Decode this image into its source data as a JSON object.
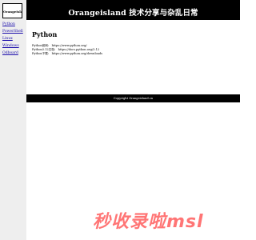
{
  "site": {
    "logo_text": "Orangeisland",
    "title": "Orangeisland 技术分享与杂乱日常"
  },
  "sidebar": {
    "items": [
      {
        "label": "Python"
      },
      {
        "label": "PowerShell"
      },
      {
        "label": "Linux"
      },
      {
        "label": "Windows"
      },
      {
        "label": "Odboard"
      }
    ]
  },
  "main": {
    "heading": "Python",
    "links": [
      {
        "text": "Python官网： https://www.python.org/"
      },
      {
        "text": "Python3.12文档： https://docs.python.org/3.12"
      },
      {
        "text": "Python下载： https://www.python.org/downloads"
      }
    ]
  },
  "footer": {
    "text": "Copyright Orangeisland.cn"
  },
  "watermark": {
    "text": "秒收录啦msl"
  }
}
